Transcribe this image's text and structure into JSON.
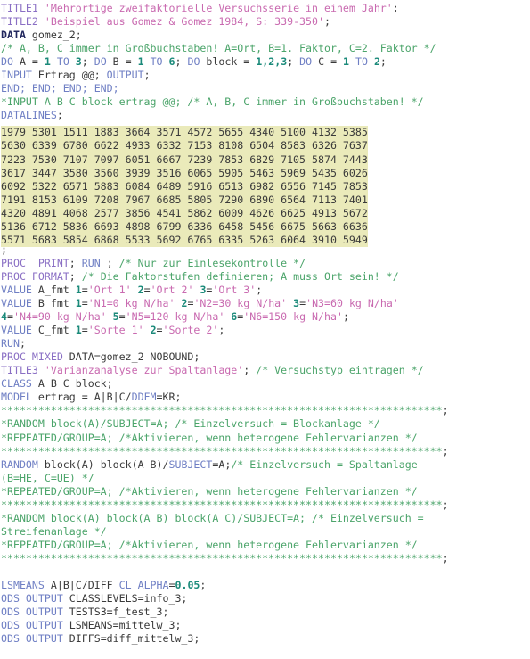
{
  "editor": {
    "language": "SAS",
    "background_color": "#ffffff",
    "datalines_highlight_color": "#eaeaba",
    "colors": {
      "keyword": "#6f7fc4",
      "proc_keyword": "#8a6fc4",
      "data_keyword": "#21275e",
      "string": "#c96ab0",
      "number": "#1b8a7a",
      "comment": "#4ba46a",
      "plain_text": "#3a3a3a"
    }
  },
  "code": {
    "title1_kw": "TITLE1 ",
    "title1_str": "'Mehrortige zweifaktorielle Versuchsserie in einem Jahr'",
    "title2_kw": "TITLE2 ",
    "title2_str": "'Beispiel aus Gomez & Gomez 1984, S: 339-350'",
    "semicolon": ";",
    "data_kw": "DATA",
    "data_name": " gomez_2;",
    "comment_abc": "/* A, B, C immer in Großbuchstaben! A=Ort, B=1. Faktor, C=2. Faktor */",
    "do_a_1": "DO",
    "do_a_2": " A = ",
    "do_a_n1": "1",
    "do_a_to": " TO ",
    "do_a_n2": "3",
    "do_a_end": "; ",
    "do_b_1": "DO",
    "do_b_2": " B = ",
    "do_b_n1": "1",
    "do_b_to": " TO ",
    "do_b_n2": "6",
    "do_b_end": "; ",
    "do_blk_1": "DO",
    "do_blk_2": " block = ",
    "do_blk_n1": "1",
    "do_blk_c1": ",",
    "do_blk_n2": "2",
    "do_blk_c2": ",",
    "do_blk_n3": "3",
    "do_blk_end": "; ",
    "do_c_1": "DO",
    "do_c_2": " C = ",
    "do_c_n1": "1",
    "do_c_to": " TO ",
    "do_c_n2": "2",
    "do_c_end": ";",
    "input_kw": "INPUT",
    "input_rest": " Ertrag @@; ",
    "output_kw": "OUTPUT",
    "output_end": ";",
    "end_line": "END; END; END; END;",
    "star_input": "*INPUT A B C block ertrag @@; /* A, B, C immer in Großbuchstaben! */",
    "datalines_kw": "DATALINES",
    "datalines_end": ";",
    "datalines_rows": [
      "1979 5301 1883 3664 3571 4572 5655 4340 5100 4132 5385",
      "5630 6339 6780 6622 4933 6332 7153 8108 6504 8583 6326 7637",
      "7223 7530 7107 7097 6051 6667 7239 7853 6829 7105 5874 7443",
      "3617 3447 3580 3560 3939 3516 6065 5905 5463 5969 5435 6026",
      "6092 5322 6571 5883 6084 6489 5916 6513 6982 6556 7145 7853",
      "7191 8153 6109 7208 7967 6685 5805 7290 6890 6564 7113 7401",
      "4320 4891 4068 2577 3856 4541 5862 6009 4626 6625 4913 5672",
      "5136 6712 5836 6693 4898 6799 6336 6458 5456 6675 5663 6636",
      "5571 5683 5854 6868 5533 5692 6765 6335 5263 6064 3910 5949"
    ],
    "datalines_row1_full": "1979 5301 1511 1883 3664 3571 4572 5655 4340 5100 4132 5385",
    "terminator": ";",
    "proc_print_kw": "PROC",
    "proc_print_kw2": "  PRINT",
    "proc_print_sc1": "; ",
    "proc_print_run": "RUN",
    "proc_print_sc2": " ; ",
    "proc_print_cmt": "/* Nur zur Einlesekontrolle */",
    "proc_format_kw": "PROC FORMAT",
    "proc_format_sc": "; ",
    "proc_format_cmt": "/* Die Faktorstufen definieren; A muss Ort sein! */",
    "value_a_kw": "VALUE",
    "value_a_name": " A_fmt ",
    "value_a_n1": "1",
    "value_a_eq1": "=",
    "value_a_s1": "'Ort 1'",
    "value_a_sp1": " ",
    "value_a_n2": "2",
    "value_a_eq2": "=",
    "value_a_s2": "'Ort 2'",
    "value_a_sp2": " ",
    "value_a_n3": "3",
    "value_a_eq3": "=",
    "value_a_s3": "'Ort 3'",
    "value_a_end": ";",
    "value_b_kw": "VALUE",
    "value_b_name": " B_fmt ",
    "value_b_n1": "1",
    "value_b_s1": "'N1=0 kg N/ha'",
    "value_b_n2": "2",
    "value_b_s2": "'N2=30 kg N/ha'",
    "value_b_n3": "3",
    "value_b_s3": "'N3=60 kg N/ha'",
    "value_b2_n4": "4",
    "value_b2_s4": "'N4=90 kg N/ha'",
    "value_b2_n5": "5",
    "value_b2_s5": "'N5=120 kg N/ha'",
    "value_b2_n6": "6",
    "value_b2_s6": "'N6=150 kg N/ha'",
    "value_c_kw": "VALUE",
    "value_c_name": " C_fmt ",
    "value_c_n1": "1",
    "value_c_s1": "'Sorte 1'",
    "value_c_n2": "2",
    "value_c_s2": "'Sorte 2'",
    "run_kw": "RUN",
    "run_end": ";",
    "proc_mixed_kw": "PROC MIXED",
    "proc_mixed_rest": " DATA=gomez_2 NOBOUND;",
    "title3_kw": "TITLE3 ",
    "title3_str": "'Varianzanalyse zur Spaltanlage'",
    "title3_sc": "; ",
    "title3_cmt": "/* Versuchstyp eintragen */",
    "class_kw": "CLASS",
    "class_rest": " A B C block;",
    "model_kw": "MODEL",
    "model_mid": " ertrag = A|B|C/",
    "model_ddfm": "DDFM",
    "model_end": "=KR;",
    "stars_long": "***********************************************************************",
    "stars_semi": ";",
    "star_random_block": "*RANDOM block(A)/SUBJECT=A; /* Einzelversuch = Blockanlage */",
    "star_repeated": "*REPEATED/GROUP=A; /*Aktivieren, wenn heterogene Fehlervarianzen */",
    "random_kw": "RANDOM",
    "random_mid": " block(A) block(A B)/",
    "random_subject": "SUBJECT",
    "random_rest": "=A;",
    "random_cmt": "/* Einzelversuch = Spaltanlage",
    "random_cmt2": "(B=HE, C=UE) */",
    "star_random_strip": "*RANDOM block(A) block(A B) block(A C)/SUBJECT=A; /* Einzelversuch =",
    "star_random_strip2": "Streifenanlage */",
    "lsmeans_kw": "LSMEANS",
    "lsmeans_mid": " A|B|C/DIFF ",
    "lsmeans_cl": "CL",
    "lsmeans_sp": " ",
    "lsmeans_alpha": "ALPHA",
    "lsmeans_eq": "=",
    "lsmeans_num": "0.05",
    "lsmeans_end": ";",
    "ods1_kw": "ODS OUTPUT",
    "ods1_rest": " CLASSLEVELS=info_3;",
    "ods2_kw": "ODS OUTPUT",
    "ods2_rest": " TESTS3=f_test_3;",
    "ods3_kw": "ODS OUTPUT",
    "ods3_rest": " LSMEANS=mittelw_3;",
    "ods4_kw": "ODS OUTPUT",
    "ods4_rest": " DIFFS=diff_mittelw_3;"
  }
}
